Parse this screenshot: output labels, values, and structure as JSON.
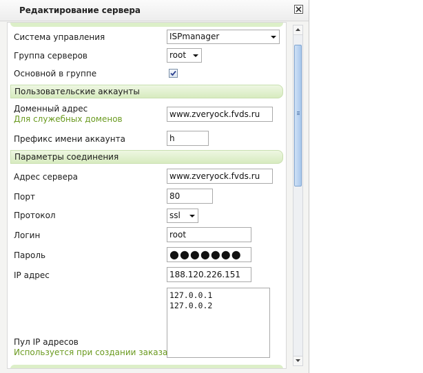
{
  "dialog": {
    "title": "Редактирование сервера",
    "close_icon": "close-icon"
  },
  "form": {
    "control_system": {
      "label": "Система управления",
      "value": "ISPmanager"
    },
    "server_group": {
      "label": "Группа серверов",
      "value": "root"
    },
    "main_in_group": {
      "label": "Основной в группе",
      "checked": true
    },
    "section_accounts": "Пользовательские аккаунты",
    "domain_address": {
      "label": "Доменный адрес",
      "hint": "Для служебных доменов",
      "value": "www.zveryock.fvds.ru"
    },
    "account_prefix": {
      "label": "Префикс имени аккаунта",
      "value": "h"
    },
    "section_connection": "Параметры соединения",
    "server_address": {
      "label": "Адрес сервера",
      "value": "www.zveryock.fvds.ru"
    },
    "port": {
      "label": "Порт",
      "value": "80"
    },
    "protocol": {
      "label": "Протокол",
      "value": "ssl"
    },
    "login": {
      "label": "Логин",
      "value": "root"
    },
    "password": {
      "label": "Пароль",
      "value": "●●●●●●●"
    },
    "ip_address": {
      "label": "IP адрес",
      "value": "188.120.226.151"
    },
    "ip_pool": {
      "label": "Пул IP адресов",
      "hint": "Используется при создании заказа",
      "lines": [
        "127.0.0.1",
        "127.0.0.2"
      ]
    }
  },
  "colors": {
    "section_bg": "#dcefc8",
    "hint_text": "#6a9a1f",
    "scroll_thumb": "#a9c8ec"
  }
}
